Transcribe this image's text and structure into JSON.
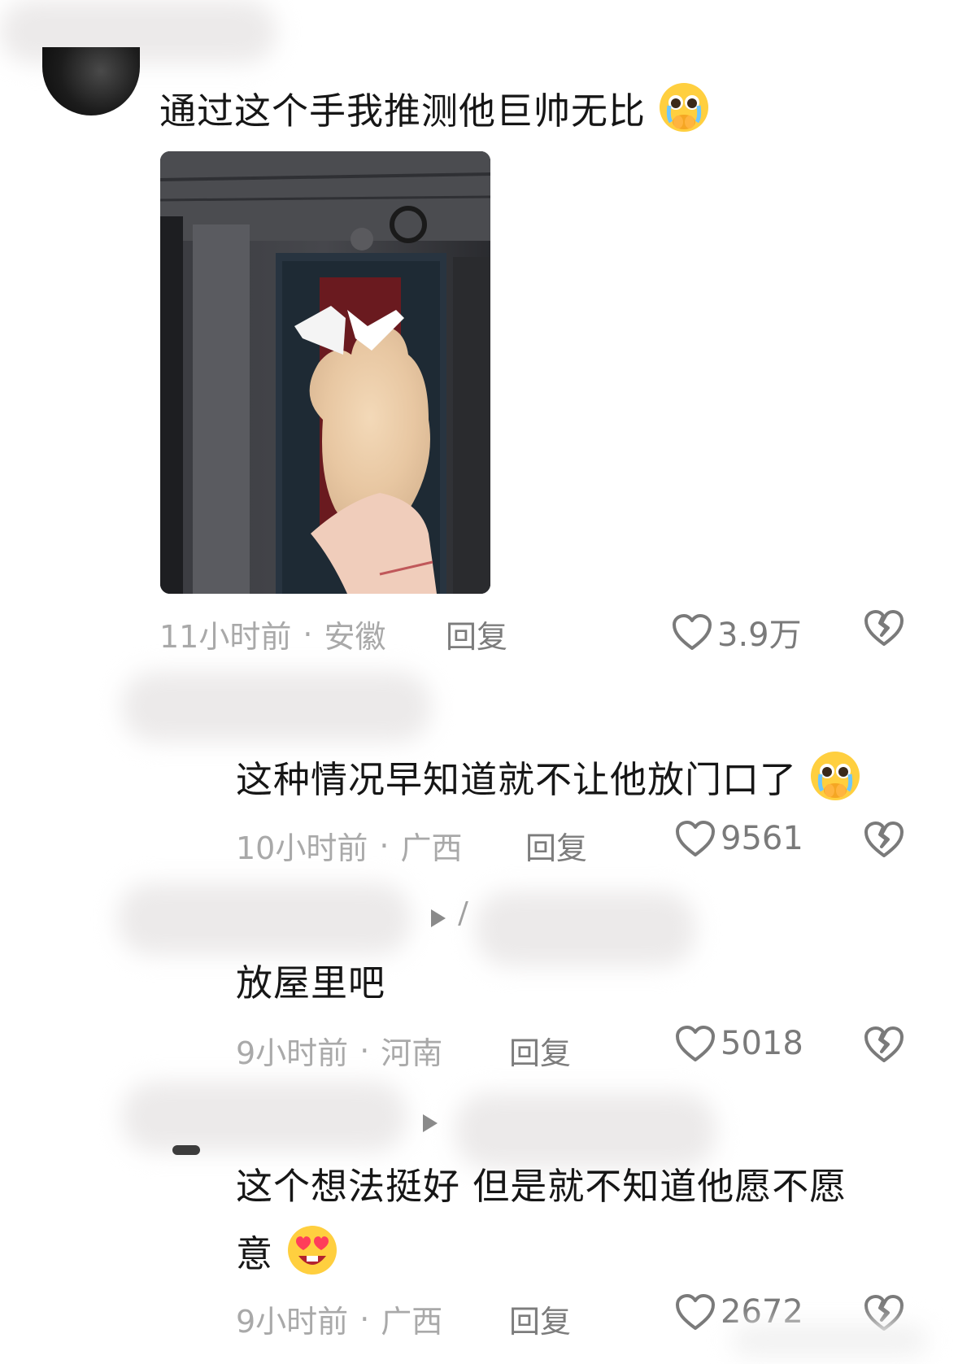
{
  "comments": [
    {
      "text": "通过这个手我推测他巨帅无比",
      "time": "11小时前",
      "location": "安徽",
      "reply_label": "回复",
      "likes": "3.9万",
      "emoji": "crying-face"
    },
    {
      "text": "这种情况早知道就不让他放门口了",
      "time": "10小时前",
      "location": "广西",
      "reply_label": "回复",
      "likes": "9561",
      "emoji": "crying-face"
    },
    {
      "text": "放屋里吧",
      "time": "9小时前",
      "location": "河南",
      "reply_label": "回复",
      "likes": "5018"
    },
    {
      "text_line1": "这个想法挺好 但是就不知道他愿不愿",
      "text_line2": "意",
      "time": "9小时前",
      "location": "广西",
      "reply_label": "回复",
      "likes": "2672",
      "emoji": "heart-eyes-face"
    }
  ],
  "separator": "·",
  "colors": {
    "text": "#161616",
    "meta": "#a9a9a9",
    "icon": "#7a7a7a",
    "background": "#ffffff"
  }
}
